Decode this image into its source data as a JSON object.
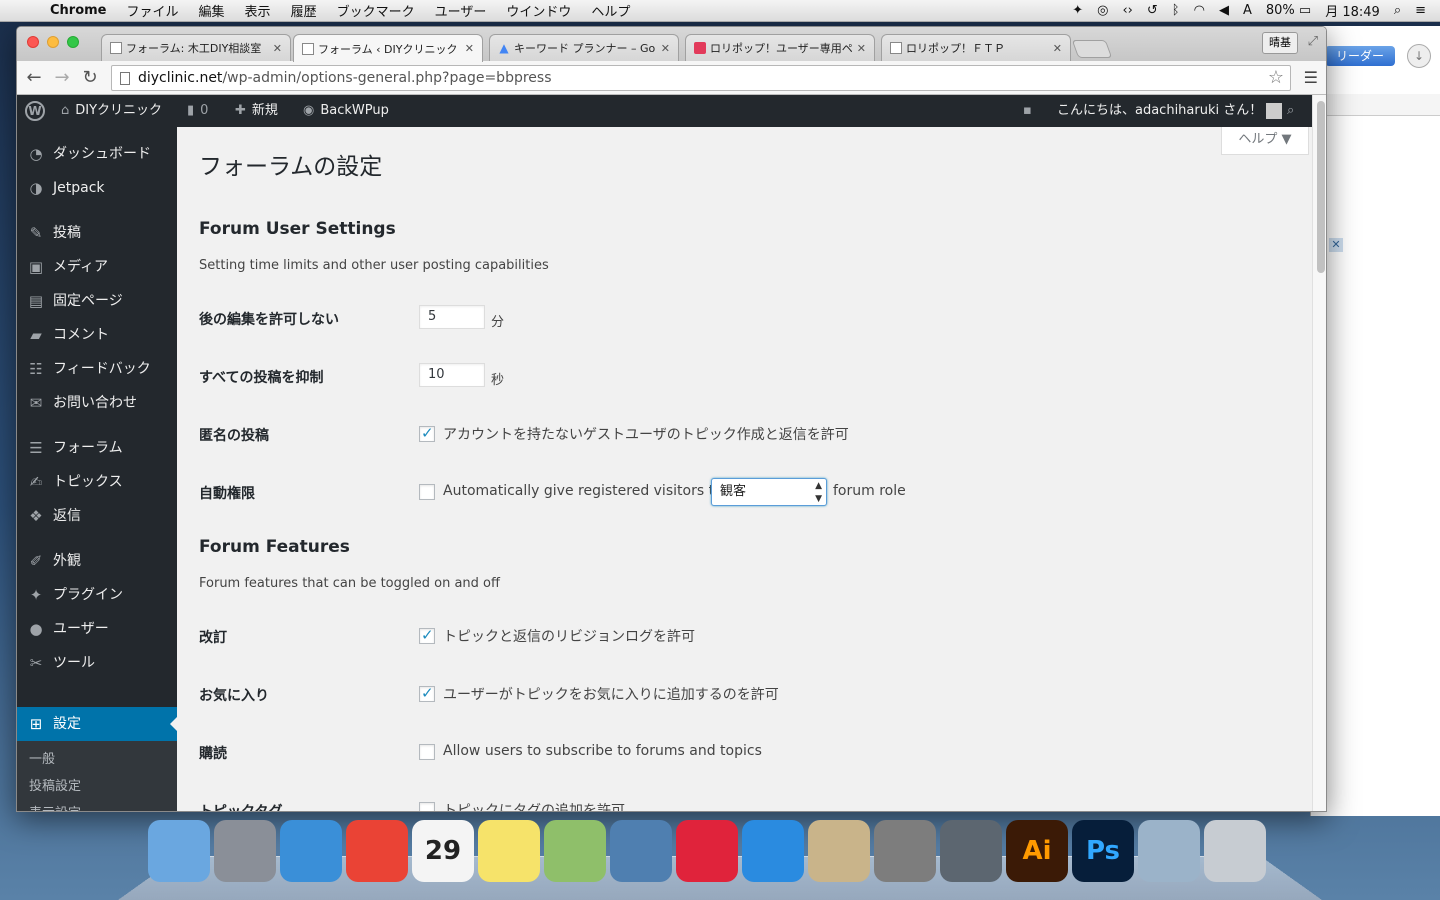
{
  "menubar": {
    "app": "Chrome",
    "items": [
      "ファイル",
      "編集",
      "表示",
      "履歴",
      "ブックマーク",
      "ユーザー",
      "ウインドウ",
      "ヘルプ"
    ],
    "battery": "80%",
    "clock": "月 18:49"
  },
  "tabs": [
    {
      "title": "フォーラム: 木工DIY相談室",
      "icon": "doc-icon"
    },
    {
      "title": "フォーラム ‹ DIYクリニック",
      "icon": "doc-icon",
      "active": true
    },
    {
      "title": "キーワード プランナー – Go",
      "icon": "google-ads-icon"
    },
    {
      "title": "ロリポップ！ユーザー専用ペ",
      "icon": "lolipop-icon"
    },
    {
      "title": "ロリポップ！ＦＴＰ",
      "icon": "doc-icon"
    }
  ],
  "profile_label": "晴基",
  "address": {
    "host": "diyclinic.net",
    "path": "/wp-admin/options-general.php?page=bbpress"
  },
  "back_window": {
    "reader_label": "リーダー"
  },
  "adminbar": {
    "site_name": "DIYクリニック",
    "comments_count": "0",
    "new_label": "新規",
    "backwpup_label": "BackWPup",
    "greeting": "こんにちは、adachiharuki さん！"
  },
  "sidebar": {
    "items": [
      {
        "label": "ダッシュボード",
        "icon": "dashboard-icon"
      },
      {
        "label": "Jetpack",
        "icon": "jetpack-icon"
      },
      {
        "label": "投稿",
        "icon": "pin-icon"
      },
      {
        "label": "メディア",
        "icon": "media-icon"
      },
      {
        "label": "固定ページ",
        "icon": "page-icon"
      },
      {
        "label": "コメント",
        "icon": "comment-icon"
      },
      {
        "label": "フィードバック",
        "icon": "feedback-icon"
      },
      {
        "label": "お問い合わせ",
        "icon": "mail-icon"
      },
      {
        "label": "フォーラム",
        "icon": "forum-icon"
      },
      {
        "label": "トピックス",
        "icon": "topics-icon"
      },
      {
        "label": "返信",
        "icon": "replies-icon"
      },
      {
        "label": "外観",
        "icon": "appearance-icon"
      },
      {
        "label": "プラグイン",
        "icon": "plugin-icon"
      },
      {
        "label": "ユーザー",
        "icon": "user-icon"
      },
      {
        "label": "ツール",
        "icon": "tools-icon"
      },
      {
        "label": "設定",
        "icon": "settings-icon",
        "current": true
      }
    ],
    "submenu": [
      "一般",
      "投稿設定",
      "表示設定"
    ]
  },
  "content": {
    "help_label": "ヘルプ ▼",
    "page_title": "フォーラムの設定",
    "user_settings": {
      "title": "Forum User Settings",
      "description": "Setting time limits and other user posting capabilities",
      "edit_lock": {
        "label": "後の編集を許可しない",
        "value": "5",
        "unit": "分"
      },
      "throttle": {
        "label": "すべての投稿を抑制",
        "value": "10",
        "unit": "秒"
      },
      "anonymous": {
        "label": "匿名の投稿",
        "checked": true,
        "text": "アカウントを持たないゲストユーザのトピック作成と返信を許可"
      },
      "auto_role": {
        "label": "自動権限",
        "checked": false,
        "text_before": "Automatically give registered visitors the",
        "selected_role": "観客",
        "text_after": "forum role"
      }
    },
    "features": {
      "title": "Forum Features",
      "description": "Forum features that can be toggled on and off",
      "revisions": {
        "label": "改訂",
        "checked": true,
        "text": "トピックと返信のリビジョンログを許可"
      },
      "favorites": {
        "label": "お気に入り",
        "checked": true,
        "text": "ユーザーがトピックをお気に入りに追加するのを許可"
      },
      "subscriptions": {
        "label": "購読",
        "checked": false,
        "text": "Allow users to subscribe to forums and topics"
      },
      "topic_tags": {
        "label": "トピックタグ",
        "checked": false,
        "text": "トピックにタグの追加を許可"
      }
    }
  },
  "dock": [
    {
      "name": "finder-icon",
      "color": "#6aa7e0"
    },
    {
      "name": "launchpad-icon",
      "color": "#8a8f98"
    },
    {
      "name": "safari-icon",
      "color": "#3a8fd8"
    },
    {
      "name": "chrome-icon",
      "color": "#ea4335"
    },
    {
      "name": "calendar-icon",
      "color": "#f4f4f4",
      "text": "29"
    },
    {
      "name": "stickies-icon",
      "color": "#f6e36a"
    },
    {
      "name": "maps-icon",
      "color": "#8fbf6a"
    },
    {
      "name": "iphoto-icon",
      "color": "#4f7fb0"
    },
    {
      "name": "itunes-icon",
      "color": "#e0233b"
    },
    {
      "name": "appstore-icon",
      "color": "#2a8be0"
    },
    {
      "name": "preview-icon",
      "color": "#c9b48a"
    },
    {
      "name": "system-preferences-icon",
      "color": "#7d7d7d"
    },
    {
      "name": "facetime-icon",
      "color": "#5c6670"
    },
    {
      "name": "illustrator-icon",
      "color": "#3b1a06",
      "text": "Ai"
    },
    {
      "name": "photoshop-icon",
      "color": "#061e3a",
      "text": "Ps"
    },
    {
      "name": "image-capture-icon",
      "color": "#9bb3c9"
    },
    {
      "name": "trash-icon",
      "color": "#c7ccd2"
    }
  ]
}
